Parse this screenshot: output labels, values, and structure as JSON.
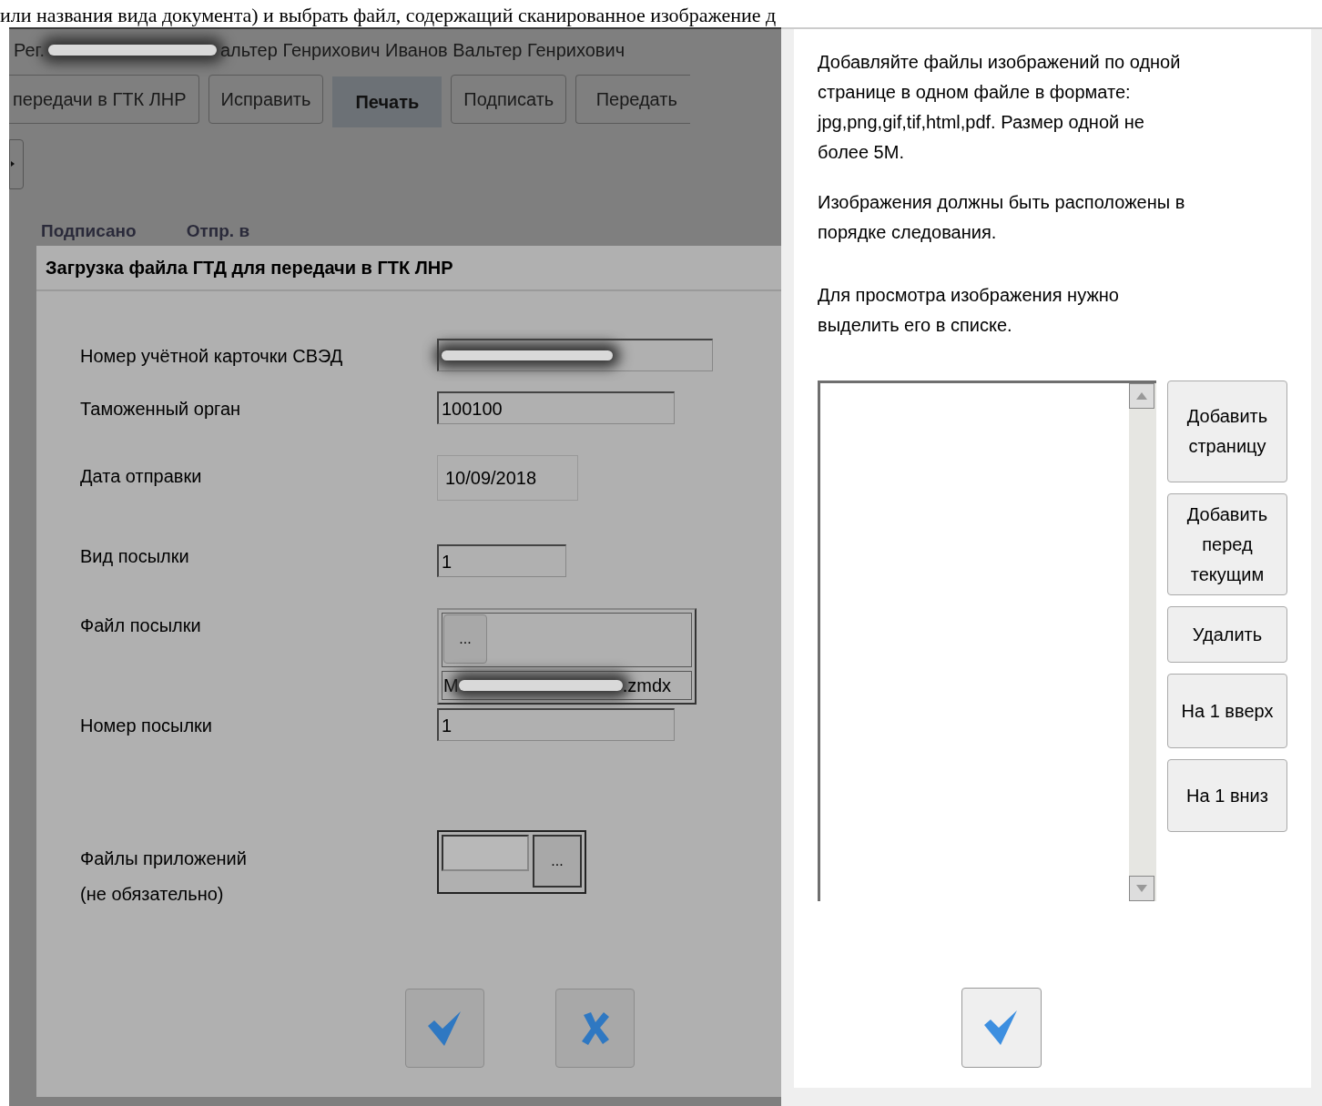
{
  "caption": "или названия вида документа) и выбрать файл, содержащий сканированное изображение д",
  "header": {
    "prefix": "Рег.",
    "name": "альтер Генрихович Иванов Вальтер Генрихович"
  },
  "toolbar": [
    {
      "label": "передачи в ГТК ЛНР",
      "selected": false
    },
    {
      "label": "Исправить",
      "selected": false
    },
    {
      "label": "Печать",
      "selected": true
    },
    {
      "label": "Подписать",
      "selected": false
    },
    {
      "label": "Передать",
      "selected": false
    }
  ],
  "columns": [
    "Подписано",
    "Отпр. в"
  ],
  "dialog": {
    "title": "Загрузка файла ГТД для передачи в ГТК ЛНР",
    "fields": [
      {
        "kind": "redacted",
        "label": "Номер учётной карточки СВЭД"
      },
      {
        "kind": "text",
        "label": "Таможенный орган",
        "value": "100100"
      },
      {
        "kind": "date",
        "label": "Дата отправки",
        "value": "10/09/2018"
      },
      {
        "kind": "short",
        "label": "Вид посылки",
        "value": "1"
      },
      {
        "kind": "file",
        "label": "Файл посылки",
        "button": "...",
        "value_start": "M",
        "value_end": ".zmdx"
      },
      {
        "kind": "text",
        "label": "Номер посылки",
        "value": "1"
      },
      {
        "kind": "attachments",
        "label": "Файлы приложений",
        "note": "(не обязательно)",
        "button": "..."
      }
    ]
  },
  "panel": {
    "paragraphs": [
      "Добавляйте файлы изображений по одной странице в одном файле в формате: jpg,png,gif,tif,html,pdf. Размер одной не более 5M.",
      "Изображения должны быть расположены в порядке следования.",
      "Для просмотра изображения нужно выделить его в списке."
    ],
    "buttons": [
      "Добавить страницу",
      "Добавить перед текущим",
      "Удалить",
      "На 1 вверх",
      "На 1 вниз"
    ]
  }
}
